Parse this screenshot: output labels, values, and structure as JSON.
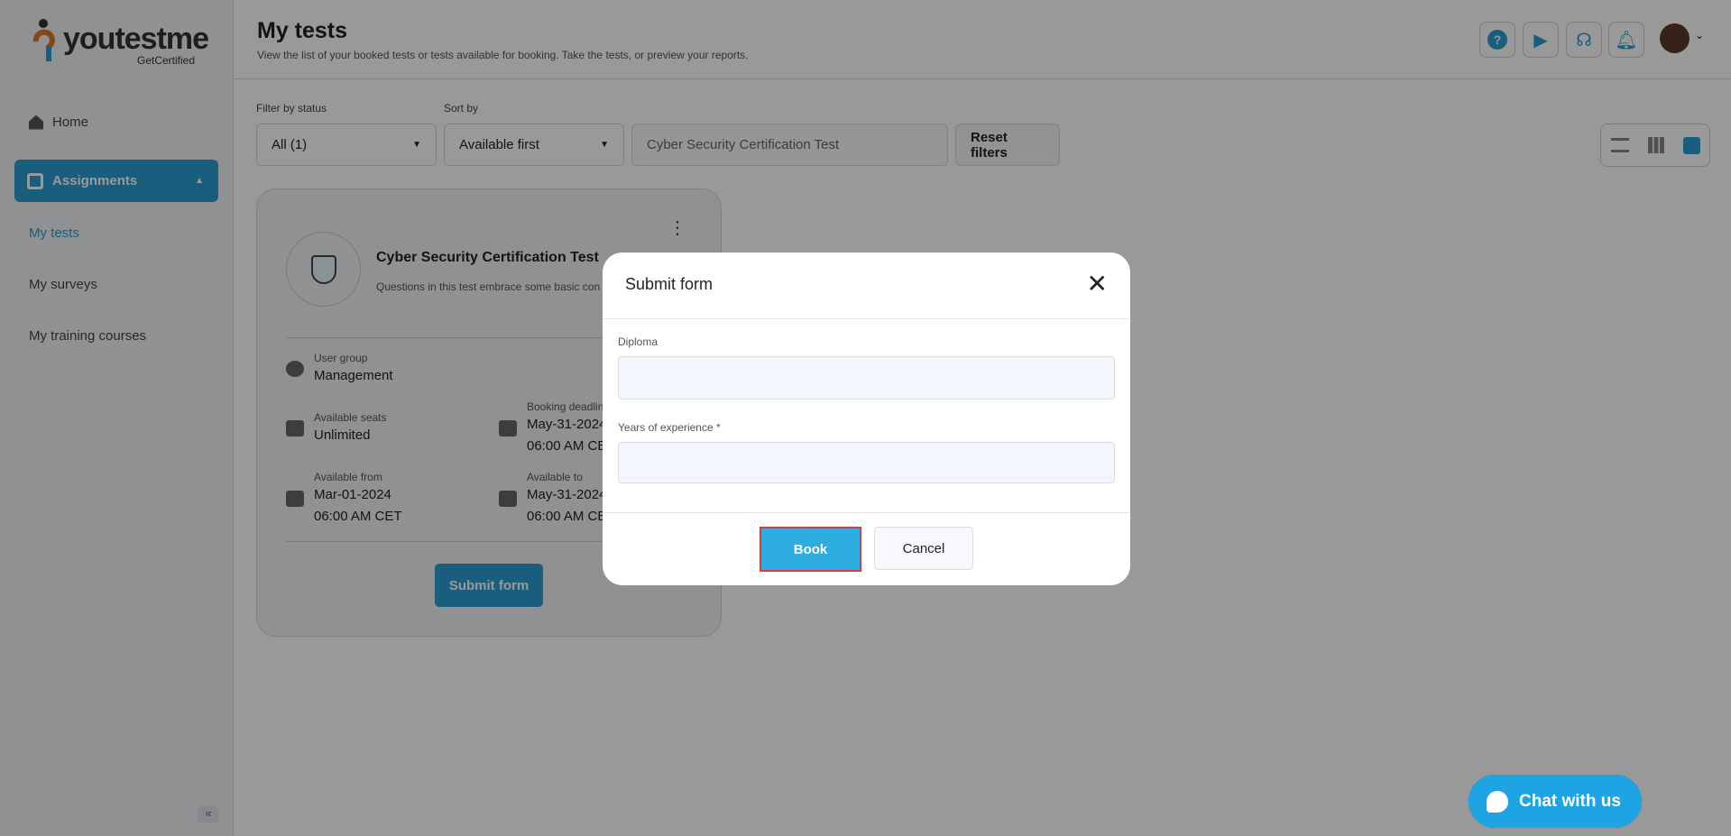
{
  "logo": {
    "word": "youtestme",
    "sub": "GetCertified"
  },
  "sidebar": {
    "home": "Home",
    "assignments": "Assignments",
    "items": [
      "My tests",
      "My surveys",
      "My training courses"
    ]
  },
  "header": {
    "title": "My tests",
    "subtitle": "View the list of your booked tests or tests available for booking. Take the tests, or preview your reports."
  },
  "filters": {
    "status_label": "Filter by status",
    "status_value": "All (1)",
    "sort_label": "Sort by",
    "sort_value": "Available first",
    "search_value": "Cyber Security Certification Test",
    "reset": "Reset filters"
  },
  "card": {
    "title": "Cyber Security Certification Test",
    "description": "Questions in this test embrace some basic con",
    "user_group_label": "User group",
    "user_group": "Management",
    "seats_label": "Available seats",
    "seats": "Unlimited",
    "deadline_label": "Booking deadlin",
    "deadline_date": "May-31-2024",
    "deadline_time": "06:00 AM CES",
    "from_label": "Available from",
    "from_date": "Mar-01-2024",
    "from_time": "06:00 AM CET",
    "to_label": "Available to",
    "to_date": "May-31-2024",
    "to_time": "06:00 AM CES",
    "submit": "Submit form"
  },
  "modal": {
    "title": "Submit form",
    "diploma_label": "Diploma",
    "diploma_value": "",
    "years_label": "Years of experience *",
    "years_value": "",
    "book": "Book",
    "cancel": "Cancel"
  },
  "chat": {
    "label": "Chat with us"
  },
  "colors": {
    "accent": "#2a9fd0",
    "book": "#2eaee0",
    "highlight": "#e53935"
  }
}
